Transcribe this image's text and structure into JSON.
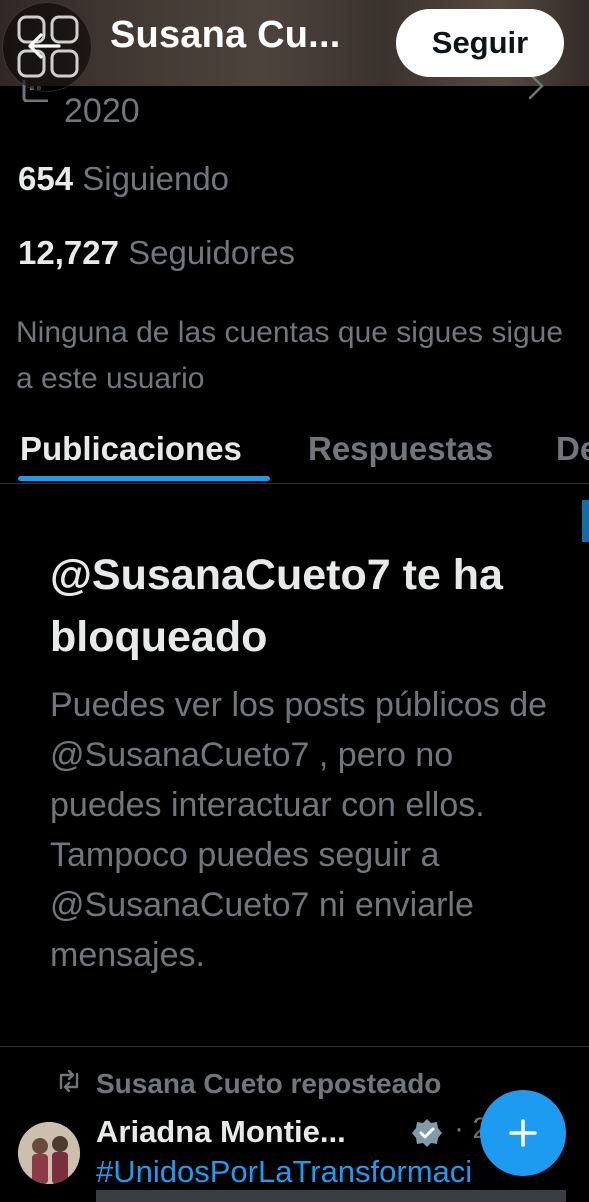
{
  "header": {
    "title": "Susana Cu...",
    "follow_label": "Seguir"
  },
  "profile": {
    "joined_year": "2020",
    "following_count": "654",
    "following_label": "Siguiendo",
    "followers_count": "12,727",
    "followers_label": "Seguidores",
    "mutual_note": "Ninguna de las cuentas que sigues sigue a este usuario"
  },
  "tabs": [
    {
      "label": "Publicaciones",
      "active": true
    },
    {
      "label": "Respuestas",
      "active": false
    },
    {
      "label": "De",
      "active": false
    }
  ],
  "blocked": {
    "title": "@SusanaCueto7 te ha bloqueado",
    "body": "Puedes ver los posts públicos de @SusanaCueto7 , pero no puedes interactuar con ellos. Tampoco puedes seguir a @SusanaCueto7 ni enviarle mensajes."
  },
  "post": {
    "repost_text": "Susana Cueto reposteado",
    "author": "Ariadna Montie...",
    "meta": "· 2",
    "hashtag": "#UnidosPorLaTransformaci"
  },
  "icons": {
    "back": "back-arrow-icon",
    "calendar": "calendar-icon",
    "chevron": "chevron-right-icon",
    "repost": "repost-icon",
    "verified": "verified-badge-icon",
    "compose": "plus-icon"
  },
  "colors": {
    "accent": "#1d9bf0",
    "background": "#000000",
    "muted_text": "#71767b"
  }
}
